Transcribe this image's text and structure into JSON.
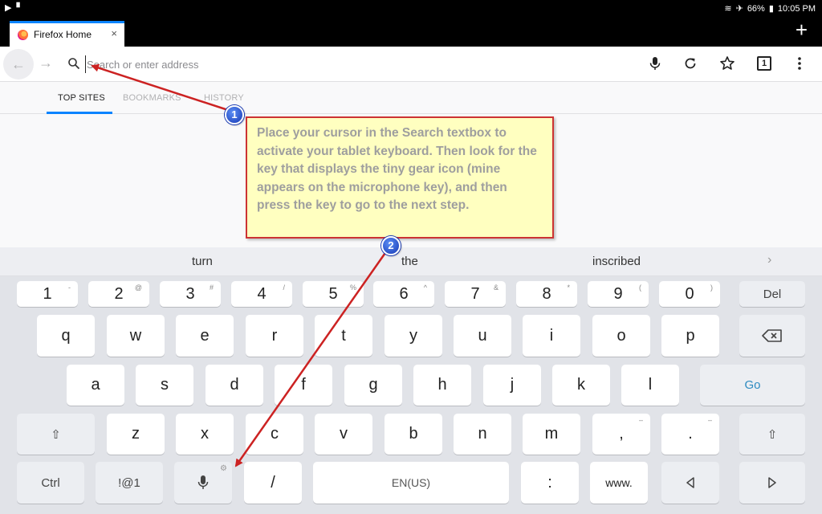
{
  "status_bar": {
    "battery": "66%",
    "time": "10:05 PM"
  },
  "tab": {
    "title": "Firefox Home",
    "close": "×"
  },
  "new_tab": "+",
  "toolbar": {
    "back": "←",
    "forward": "→",
    "url_placeholder": "Search or enter address",
    "tabs_count": "1"
  },
  "panel_tabs": {
    "top_sites": "TOP SITES",
    "bookmarks": "BOOKMARKS",
    "history": "HISTORY"
  },
  "suggestions": [
    "turn",
    "the",
    "inscribed"
  ],
  "keyboard": {
    "row1": [
      {
        "label": "1",
        "sub": "-"
      },
      {
        "label": "2",
        "sub": "@"
      },
      {
        "label": "3",
        "sub": "#"
      },
      {
        "label": "4",
        "sub": "/"
      },
      {
        "label": "5",
        "sub": "%"
      },
      {
        "label": "6",
        "sub": "^"
      },
      {
        "label": "7",
        "sub": "&"
      },
      {
        "label": "8",
        "sub": "*"
      },
      {
        "label": "9",
        "sub": "("
      },
      {
        "label": "0",
        "sub": ")"
      },
      {
        "label": "Del",
        "sub": ""
      }
    ],
    "row2": [
      "q",
      "w",
      "e",
      "r",
      "t",
      "y",
      "u",
      "i",
      "o",
      "p"
    ],
    "row3": [
      "a",
      "s",
      "d",
      "f",
      "g",
      "h",
      "j",
      "k",
      "l"
    ],
    "go": "Go",
    "row4": [
      "z",
      "x",
      "c",
      "v",
      "b",
      "n",
      "m"
    ],
    "comma": ",",
    "period": ".",
    "row4_subs": [
      "–",
      "–"
    ],
    "ctrl": "Ctrl",
    "symbols": "!@1",
    "slash": "/",
    "space": "EN(US)",
    "colon": ":",
    "www": "www."
  },
  "callout": {
    "text": "Place your cursor in the Search textbox to activate your tablet keyboard. Then look for the key that displays the tiny gear icon (mine appears on the microphone key), and then press the key to go to the next step."
  },
  "badges": [
    "1",
    "2"
  ],
  "colors": {
    "accent": "#0a84ff",
    "callout_bg": "#ffffc0",
    "arrow": "#cc2222"
  }
}
